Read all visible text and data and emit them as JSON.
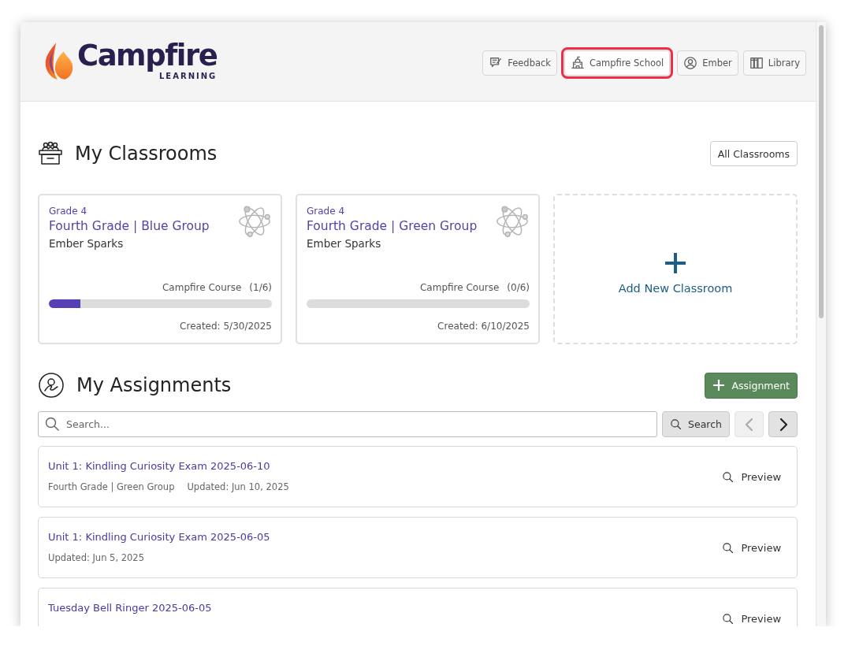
{
  "header": {
    "logo": {
      "name": "Campfire",
      "tagline": "LEARNING"
    },
    "nav": [
      {
        "label": "Feedback",
        "highlighted": false
      },
      {
        "label": "Campfire School",
        "highlighted": true
      },
      {
        "label": "Ember",
        "highlighted": false
      },
      {
        "label": "Library",
        "highlighted": false
      }
    ]
  },
  "classrooms": {
    "title": "My Classrooms",
    "all_button": "All Classrooms",
    "cards": [
      {
        "grade": "Grade 4",
        "name": "Fourth Grade | Blue Group",
        "teacher": "Ember Sparks",
        "course": "Campfire Course",
        "progress": "(1/6)",
        "level": 0.14,
        "created": "Created: 5/30/2025"
      },
      {
        "grade": "Grade 4",
        "name": "Fourth Grade | Green Group",
        "teacher": "Ember Sparks",
        "course": "Campfire Course",
        "progress": "(0/6)",
        "level": 0,
        "created": "Created: 6/10/2025"
      }
    ],
    "add_card": {
      "label": "Add New Classroom"
    }
  },
  "assignments": {
    "title": "My Assignments",
    "add_button": "Assignment",
    "search": {
      "placeholder": "Search...",
      "button": "Search"
    },
    "pager": {
      "prev_disabled": true,
      "next_disabled": false
    },
    "items": [
      {
        "title": "Unit 1: Kindling Curiosity Exam 2025-06-10",
        "meta": [
          "Fourth Grade | Green Group",
          "Updated: Jun 10, 2025"
        ],
        "action": "Preview"
      },
      {
        "title": "Unit 1: Kindling Curiosity Exam 2025-06-05",
        "meta": [
          "Updated: Jun 5, 2025"
        ],
        "action": "Preview"
      },
      {
        "title": "Tuesday Bell Ringer 2025-06-05",
        "action": "Preview"
      }
    ]
  }
}
